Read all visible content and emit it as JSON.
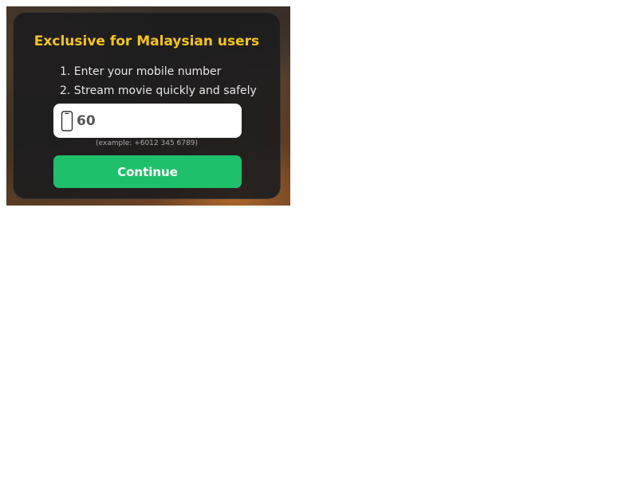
{
  "card": {
    "title": "Exclusive for Malaysian users",
    "steps": [
      "1. Enter your mobile number",
      "2. Stream movie quickly and safely"
    ],
    "phone_input": {
      "value": "60",
      "icon": "mobile-phone-icon"
    },
    "example_hint": "(example: +6012 345 6789)",
    "continue_label": "Continue"
  },
  "colors": {
    "title": "#f5c518",
    "button": "#1fc06c",
    "card_background": "#1c1c1e"
  }
}
